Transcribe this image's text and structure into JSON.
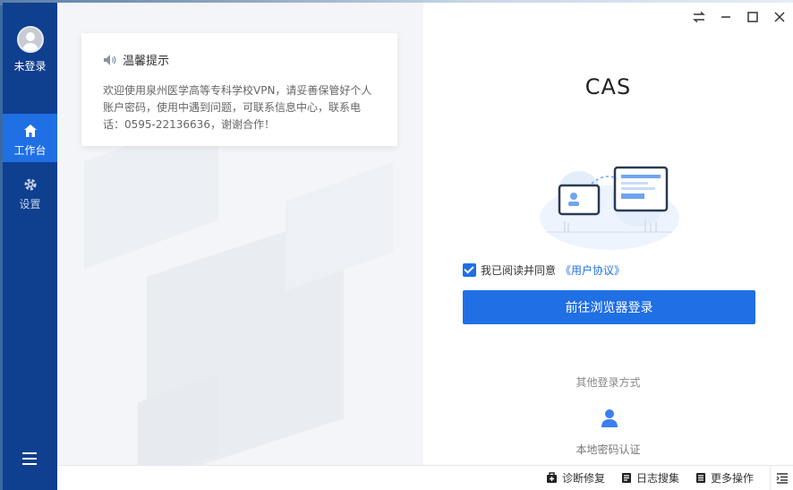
{
  "sidebar": {
    "login_status": "未登录",
    "items": [
      {
        "label": "工作台",
        "icon": "home-icon",
        "active": true
      },
      {
        "label": "设置",
        "icon": "gear-icon",
        "active": false
      }
    ],
    "menu_icon": "hamburger-menu-icon"
  },
  "notice": {
    "title": "温馨提示",
    "icon": "speaker-icon",
    "body": "欢迎使用泉州医学高等专科学校VPN，请妥善保管好个人账户密码，使用中遇到问题，可联系信息中心，联系电话：0595-22136636，谢谢合作！"
  },
  "login": {
    "title": "CAS",
    "agree_text": "我已阅读并同意",
    "agree_link": "《用户协议》",
    "agree_checked": true,
    "button_label": "前往浏览器登录",
    "other_methods_label": "其他登录方式",
    "local_auth_label": "本地密码认证"
  },
  "footer": {
    "items": [
      {
        "label": "诊断修复",
        "icon": "diagnose-icon"
      },
      {
        "label": "日志搜集",
        "icon": "log-icon"
      },
      {
        "label": "更多操作",
        "icon": "more-icon"
      }
    ],
    "end_icon": "list-icon"
  },
  "colors": {
    "sidebar_bg": "#0f3f8f",
    "accent": "#1f6fe5"
  }
}
